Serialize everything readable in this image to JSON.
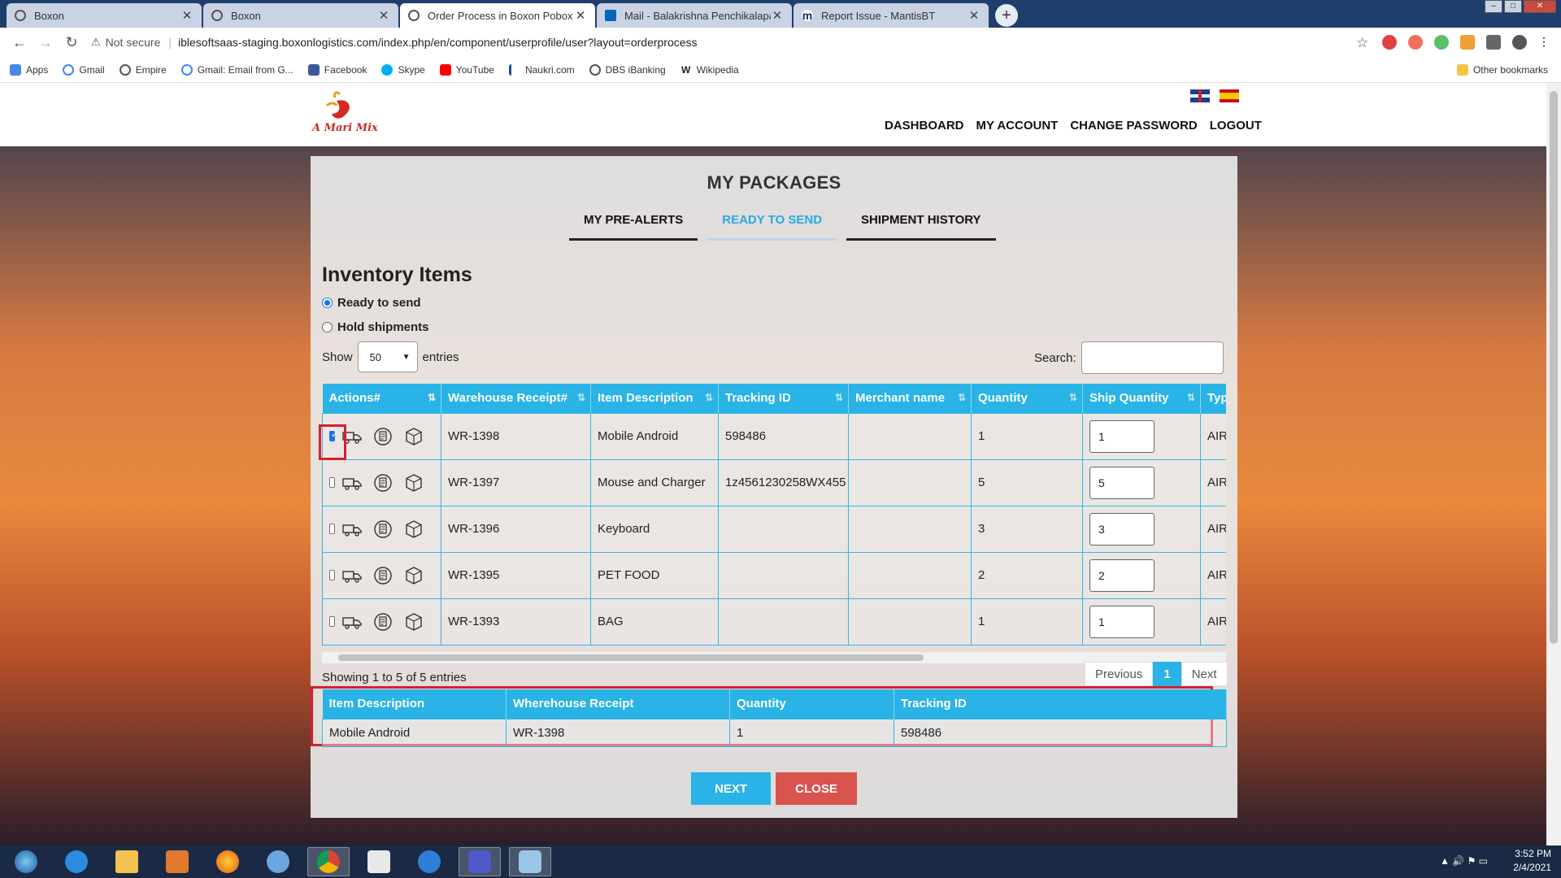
{
  "browser": {
    "tabs": [
      {
        "title": "Boxon",
        "icon": "globe-icon",
        "active": false
      },
      {
        "title": "Boxon",
        "icon": "globe-icon",
        "active": false
      },
      {
        "title": "Order Process in Boxon Pobox Sc",
        "icon": "globe-icon",
        "active": true
      },
      {
        "title": "Mail - Balakrishna Penchikalapati",
        "icon": "outlook-icon",
        "active": false
      },
      {
        "title": "Report Issue - MantisBT",
        "icon": "mantis-icon",
        "active": false
      }
    ],
    "security_label": "Not secure",
    "url": "iblesoftsaas-staging.boxonlogistics.com/index.php/en/component/userprofile/user?layout=orderprocess",
    "bookmarks": [
      "Apps",
      "Gmail",
      "Empire",
      "Gmail: Email from G...",
      "Facebook",
      "Skype",
      "YouTube",
      "Naukri.com",
      "DBS iBanking",
      "Wikipedia"
    ],
    "other_bookmarks": "Other bookmarks"
  },
  "site": {
    "logo_text": "A Mari Mix",
    "nav": [
      "DASHBOARD",
      "MY ACCOUNT",
      "CHANGE PASSWORD",
      "LOGOUT"
    ]
  },
  "packages": {
    "title": "MY PACKAGES",
    "tabs": [
      {
        "label": "MY PRE-ALERTS",
        "active": false
      },
      {
        "label": "READY TO SEND",
        "active": true
      },
      {
        "label": "SHIPMENT HISTORY",
        "active": false
      }
    ],
    "section_title": "Inventory Items",
    "radios": [
      {
        "label": "Ready to send",
        "checked": true
      },
      {
        "label": "Hold shipments",
        "checked": false
      }
    ],
    "show_label": "Show",
    "entries_value": "50",
    "entries_label": "entries",
    "search_label": "Search:",
    "columns": [
      "Actions#",
      "Warehouse Receipt#",
      "Item Description",
      "Tracking ID",
      "Merchant name",
      "Quantity",
      "Ship Quantity",
      "Type"
    ],
    "rows": [
      {
        "checked": true,
        "receipt": "WR-1398",
        "description": "Mobile Android",
        "tracking": "598486",
        "merchant": "",
        "quantity": "1",
        "ship_qty": "1",
        "type": "AIR"
      },
      {
        "checked": false,
        "receipt": "WR-1397",
        "description": "Mouse and Charger",
        "tracking": "1z4561230258WX455",
        "merchant": "",
        "quantity": "5",
        "ship_qty": "5",
        "type": "AIR"
      },
      {
        "checked": false,
        "receipt": "WR-1396",
        "description": "Keyboard",
        "tracking": "",
        "merchant": "",
        "quantity": "3",
        "ship_qty": "3",
        "type": "AIR"
      },
      {
        "checked": false,
        "receipt": "WR-1395",
        "description": "PET FOOD",
        "tracking": "",
        "merchant": "",
        "quantity": "2",
        "ship_qty": "2",
        "type": "AIR"
      },
      {
        "checked": false,
        "receipt": "WR-1393",
        "description": "BAG",
        "tracking": "",
        "merchant": "",
        "quantity": "1",
        "ship_qty": "1",
        "type": "AIR"
      }
    ],
    "showing_text": "Showing 1 to 5 of 5 entries",
    "pager": {
      "prev": "Previous",
      "current": "1",
      "next": "Next"
    },
    "selected": {
      "columns": [
        "Item Description",
        "Wherehouse Receipt",
        "Quantity",
        "Tracking ID"
      ],
      "rows": [
        {
          "description": "Mobile Android",
          "receipt": "WR-1398",
          "quantity": "1",
          "tracking": "598486"
        }
      ]
    },
    "buttons": {
      "next": "NEXT",
      "close": "CLOSE"
    }
  },
  "taskbar": {
    "time": "3:52 PM",
    "date": "2/4/2021"
  }
}
